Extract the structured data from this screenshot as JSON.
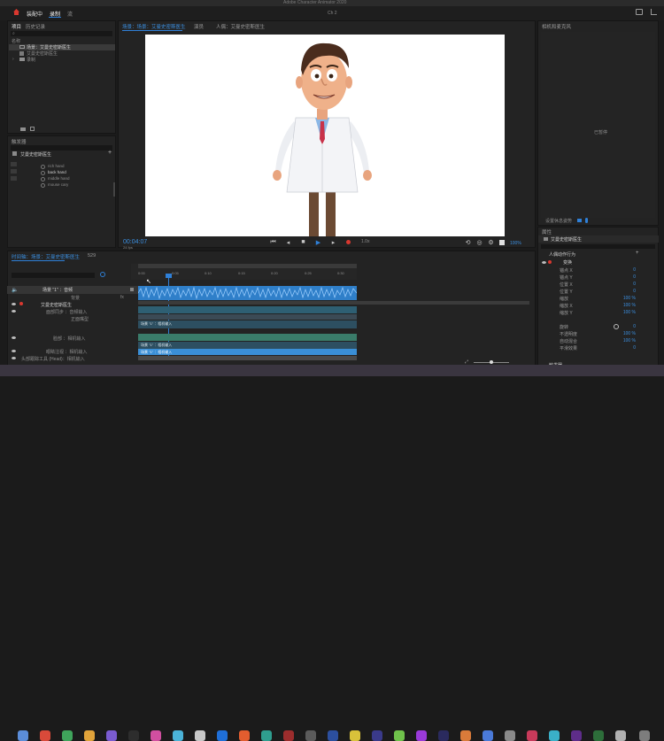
{
  "app": {
    "window_title": "Adobe Character Animator 2020",
    "doc_title": "Ch 2",
    "mode_tabs": [
      "装配中",
      "录制",
      "流"
    ],
    "menu_right_icon": "comment-icon"
  },
  "project_panel": {
    "tabs": [
      "项目",
      "历史记录"
    ],
    "name_header": "名称",
    "items": [
      {
        "label": "场景：艾曼史密斯医生",
        "type": "scene"
      },
      {
        "label": "艾曼史密斯医生",
        "type": "puppet"
      },
      {
        "label": "录制",
        "type": "folder"
      }
    ]
  },
  "triggers_panel": {
    "title": "触发器",
    "puppet_label": "艾曼史密斯医生",
    "swap_items": [
      "rich hand",
      "back hand",
      "middle hand",
      "mouse cary"
    ]
  },
  "scene_panel": {
    "tabs": [
      "场景：场景：艾曼史密斯医生",
      "演员",
      "人偶：艾曼史密斯医生"
    ],
    "timecode": "00:04:07",
    "fps": "24 fps",
    "zoom": "100%"
  },
  "camera_panel": {
    "title": "相机和麦克风",
    "placeholder": "已暂停",
    "set_rest_label": "设置休息姿势"
  },
  "properties_panel": {
    "title": "属性",
    "puppet_name": "艾曼史密斯医生",
    "section": "人偶动作行为",
    "group": "变换",
    "rows": [
      {
        "label": "锚点 X",
        "value": "0"
      },
      {
        "label": "锚点 Y",
        "value": "0"
      },
      {
        "label": "位置 X",
        "value": "0"
      },
      {
        "label": "位置 Y",
        "value": "0"
      },
      {
        "label": "缩放",
        "value": "100 %"
      },
      {
        "label": "缩放 X",
        "value": "100 %"
      },
      {
        "label": "缩放 Y",
        "value": "100 %"
      },
      {
        "label": "旋转",
        "value": "0"
      },
      {
        "label": "不透明度",
        "value": "100 %"
      },
      {
        "label": "自动混合",
        "value": "100 %"
      },
      {
        "label": "平滑效果",
        "value": "0"
      }
    ],
    "footer": "触发器"
  },
  "timeline_panel": {
    "tabs": [
      "时间轴：场景：艾曼史密斯医生",
      "529"
    ],
    "ruler": [
      "0:00",
      "0:05",
      "0:10",
      "0:15",
      "0:20",
      "0:25",
      "0:30",
      "0:35"
    ],
    "tracks": [
      {
        "label": "场景 \"1\" ：音频"
      },
      {
        "label": "背景"
      },
      {
        "label": "艾曼史密斯医生"
      },
      {
        "label": "面部同步 ：音频输入"
      },
      {
        "label": "正面嘴型"
      },
      {
        "label": "脸部 ：相机输入"
      },
      {
        "label": "眼睛注视 ：相机输入"
      },
      {
        "label": "头部跟踪工具 (Head)：相机输入"
      }
    ],
    "clips": [
      "场景 \"1\" ：相机输入",
      "场景 \"1\" ：相机输入",
      "场景 \"1\" ：相机输入"
    ]
  },
  "colors": {
    "accent": "#2f80d8",
    "audio_clip": "#3a8fd6",
    "clip_teal": "#2f6f78",
    "clip_green": "#3a7c6a",
    "record_red": "#d9382f"
  }
}
